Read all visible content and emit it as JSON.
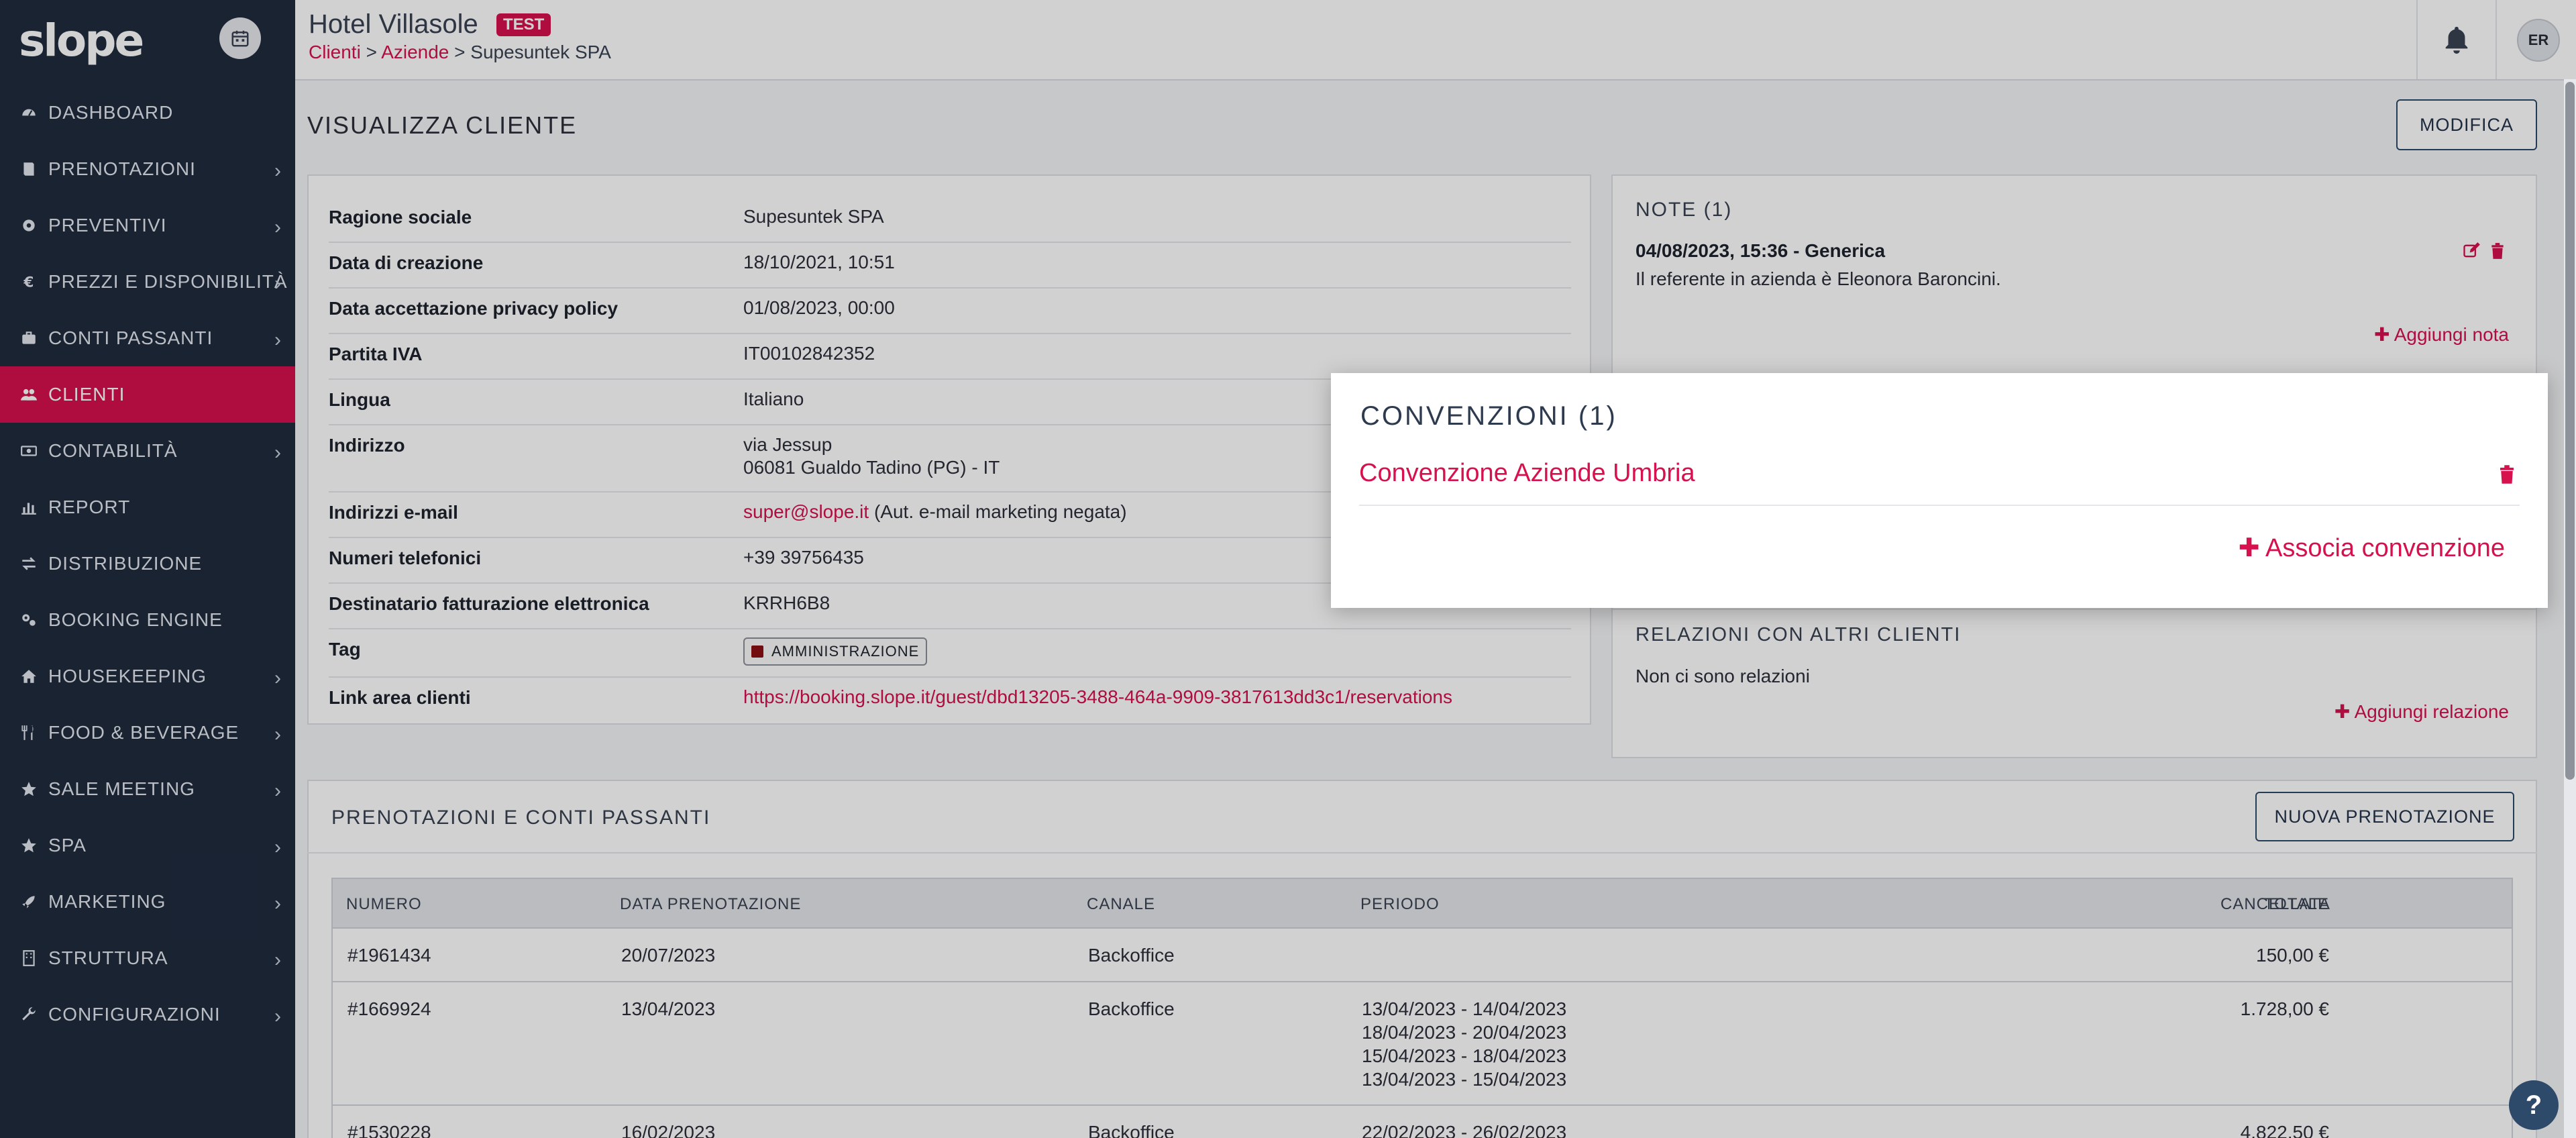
{
  "app": {
    "logo": "slope"
  },
  "sidebar": {
    "items": [
      {
        "label": "DASHBOARD",
        "icon": "gauge-icon",
        "chevron": false
      },
      {
        "label": "PRENOTAZIONI",
        "icon": "book-icon",
        "chevron": true
      },
      {
        "label": "PREVENTIVI",
        "icon": "cog-icon",
        "chevron": true
      },
      {
        "label": "PREZZI E DISPONIBILITÀ",
        "icon": "euro-icon",
        "chevron": true
      },
      {
        "label": "CONTI PASSANTI",
        "icon": "briefcase-icon",
        "chevron": true
      },
      {
        "label": "CLIENTI",
        "icon": "users-icon",
        "chevron": false,
        "active": true
      },
      {
        "label": "CONTABILITÀ",
        "icon": "money-icon",
        "chevron": true
      },
      {
        "label": "REPORT",
        "icon": "bar-chart-icon",
        "chevron": false
      },
      {
        "label": "DISTRIBUZIONE",
        "icon": "exchange-icon",
        "chevron": false
      },
      {
        "label": "BOOKING ENGINE",
        "icon": "cogs-icon",
        "chevron": false
      },
      {
        "label": "HOUSEKEEPING",
        "icon": "home-icon",
        "chevron": true
      },
      {
        "label": "FOOD & BEVERAGE",
        "icon": "cutlery-icon",
        "chevron": true
      },
      {
        "label": "SALE MEETING",
        "icon": "star-icon",
        "chevron": true
      },
      {
        "label": "SPA",
        "icon": "star-icon",
        "chevron": true
      },
      {
        "label": "MARKETING",
        "icon": "rocket-icon",
        "chevron": true
      },
      {
        "label": "STRUTTURA",
        "icon": "building-icon",
        "chevron": true
      },
      {
        "label": "CONFIGURAZIONI",
        "icon": "wrench-icon",
        "chevron": true
      }
    ]
  },
  "header": {
    "hotel": "Hotel Villasole",
    "badge": "TEST",
    "breadcrumb": [
      "Clienti",
      "Aziende",
      "Supesuntek SPA"
    ],
    "avatar": "ER"
  },
  "page": {
    "title": "VISUALIZZA CLIENTE",
    "edit_label": "MODIFICA"
  },
  "client": {
    "rows": [
      {
        "label": "Ragione sociale",
        "value": "Supesuntek SPA"
      },
      {
        "label": "Data di creazione",
        "value": "18/10/2021, 10:51"
      },
      {
        "label": "Data accettazione privacy policy",
        "value": "01/08/2023, 00:00"
      },
      {
        "label": "Partita IVA",
        "value": "IT00102842352"
      },
      {
        "label": "Lingua",
        "value": "Italiano"
      },
      {
        "label": "Indirizzo",
        "value": "via Jessup",
        "value2": "06081 Gualdo Tadino (PG) - IT"
      },
      {
        "label": "Indirizzi e-mail",
        "value": "super@slope.it",
        "value2": " (Aut. e-mail marketing negata)"
      },
      {
        "label": "Numeri telefonici",
        "value": "+39 39756435"
      },
      {
        "label": "Destinatario fatturazione elettronica",
        "value": "KRRH6B8"
      },
      {
        "label": "Tag",
        "value": "AMMINISTRAZIONE"
      },
      {
        "label": "Link area clienti",
        "value": "https://booking.slope.it/guest/dbd13205-3488-464a-9909-3817613dd3c1/reservations"
      }
    ]
  },
  "notes": {
    "title": "NOTE (1)",
    "note_header": "04/08/2023, 15:36 - Generica",
    "note_text": "Il referente in azienda è Eleonora Baroncini.",
    "add_label": "Aggiungi nota"
  },
  "conventions": {
    "title": "CONVENZIONI (1)",
    "item": "Convenzione Aziende Umbria",
    "add_label": "Associa convenzione"
  },
  "relations": {
    "title": "RELAZIONI CON ALTRI CLIENTI",
    "empty": "Non ci sono relazioni",
    "add_label": "Aggiungi relazione"
  },
  "bookings": {
    "title": "PRENOTAZIONI E CONTI PASSANTI",
    "new_label": "NUOVA PRENOTAZIONE",
    "columns": [
      "NUMERO",
      "DATA PRENOTAZIONE",
      "CANALE",
      "PERIODO",
      "TOTALE",
      "CANCELLATA"
    ],
    "rows": [
      {
        "numero": "#1961434",
        "data": "20/07/2023",
        "canale": "Backoffice",
        "periodo": [],
        "totale": "150,00 €"
      },
      {
        "numero": "#1669924",
        "data": "13/04/2023",
        "canale": "Backoffice",
        "periodo": [
          "13/04/2023 - 14/04/2023",
          "18/04/2023 - 20/04/2023",
          "15/04/2023 - 18/04/2023",
          "13/04/2023 - 15/04/2023"
        ],
        "totale": "1.728,00 €"
      },
      {
        "numero": "#1530228",
        "data": "16/02/2023",
        "canale": "Backoffice",
        "periodo": [
          "22/02/2023 - 26/02/2023"
        ],
        "totale": "4.822,50 €"
      }
    ]
  },
  "help": {
    "label": "?"
  },
  "colors": {
    "accent": "#d6114e",
    "sidebar": "#1f2b3e",
    "navy": "#2e4a6b"
  }
}
